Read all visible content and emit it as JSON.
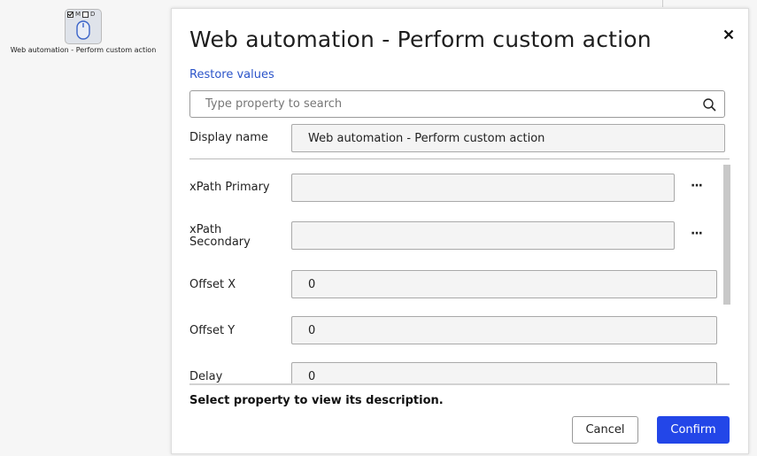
{
  "canvas": {
    "node": {
      "flag_m": "M",
      "flag_d": "D",
      "label": "Web automation - Perform custom action"
    }
  },
  "dialog": {
    "title": "Web automation - Perform custom action",
    "restore_label": "Restore values",
    "search": {
      "placeholder": "Type property to search",
      "value": ""
    },
    "display_name": {
      "label": "Display name",
      "value": "Web automation - Perform custom action"
    },
    "properties": [
      {
        "label": "xPath Primary",
        "value": "",
        "has_picker": true,
        "picker_label": "···"
      },
      {
        "label": "xPath Secondary",
        "value": "",
        "has_picker": true,
        "picker_label": "···"
      },
      {
        "label": "Offset X",
        "value": "0",
        "has_picker": false
      },
      {
        "label": "Offset Y",
        "value": "0",
        "has_picker": false
      },
      {
        "label": "Delay",
        "value": "0",
        "has_picker": false
      }
    ],
    "description": "Select property to view its description.",
    "cancel_label": "Cancel",
    "confirm_label": "Confirm"
  },
  "colors": {
    "accent": "#2346e8",
    "link": "#2b54c9",
    "field_bg": "#f4f4f4"
  }
}
